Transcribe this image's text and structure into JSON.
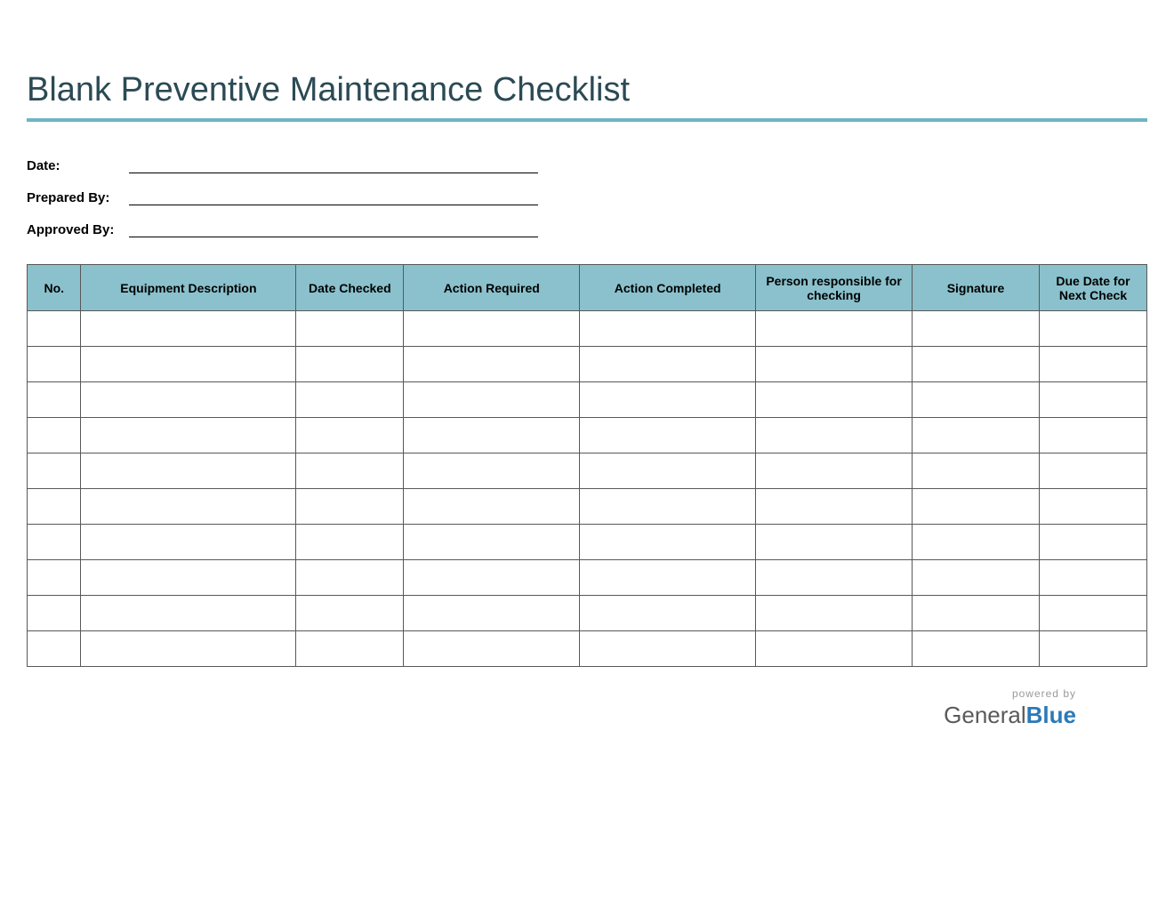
{
  "title": "Blank Preventive Maintenance Checklist",
  "form": {
    "date_label": "Date:",
    "prepared_by_label": "Prepared By:",
    "approved_by_label": "Approved By:"
  },
  "table": {
    "headers": {
      "no": "No.",
      "description": "Equipment Description",
      "date_checked": "Date Checked",
      "action_required": "Action Required",
      "action_completed": "Action Completed",
      "person_responsible": "Person responsible for checking",
      "signature": "Signature",
      "due_date": "Due Date for Next Check"
    },
    "row_count": 10
  },
  "footer": {
    "powered_by": "powered by",
    "brand_part1": "General",
    "brand_part2": "Blue"
  }
}
